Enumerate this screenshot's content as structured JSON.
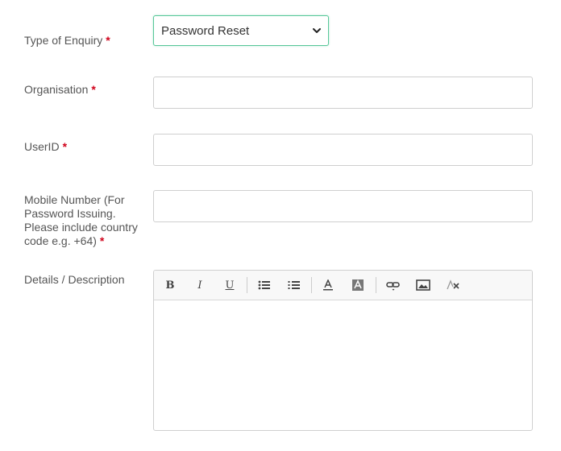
{
  "fields": {
    "enquiry": {
      "label": "Type of Enquiry",
      "required": "*",
      "selected": "Password Reset"
    },
    "organisation": {
      "label": "Organisation",
      "required": "*",
      "value": ""
    },
    "userid": {
      "label": "UserID",
      "required": "*",
      "value": ""
    },
    "mobile": {
      "label": "Mobile Number (For Password Issuing. Please include country code e.g. +64)",
      "required": "*",
      "value": ""
    },
    "details": {
      "label": "Details / Description",
      "value": ""
    }
  },
  "toolbar": {
    "bold": "B",
    "italic": "I",
    "underline": "U"
  },
  "colors": {
    "required": "#d0021b",
    "focus_border": "#59c79a"
  }
}
